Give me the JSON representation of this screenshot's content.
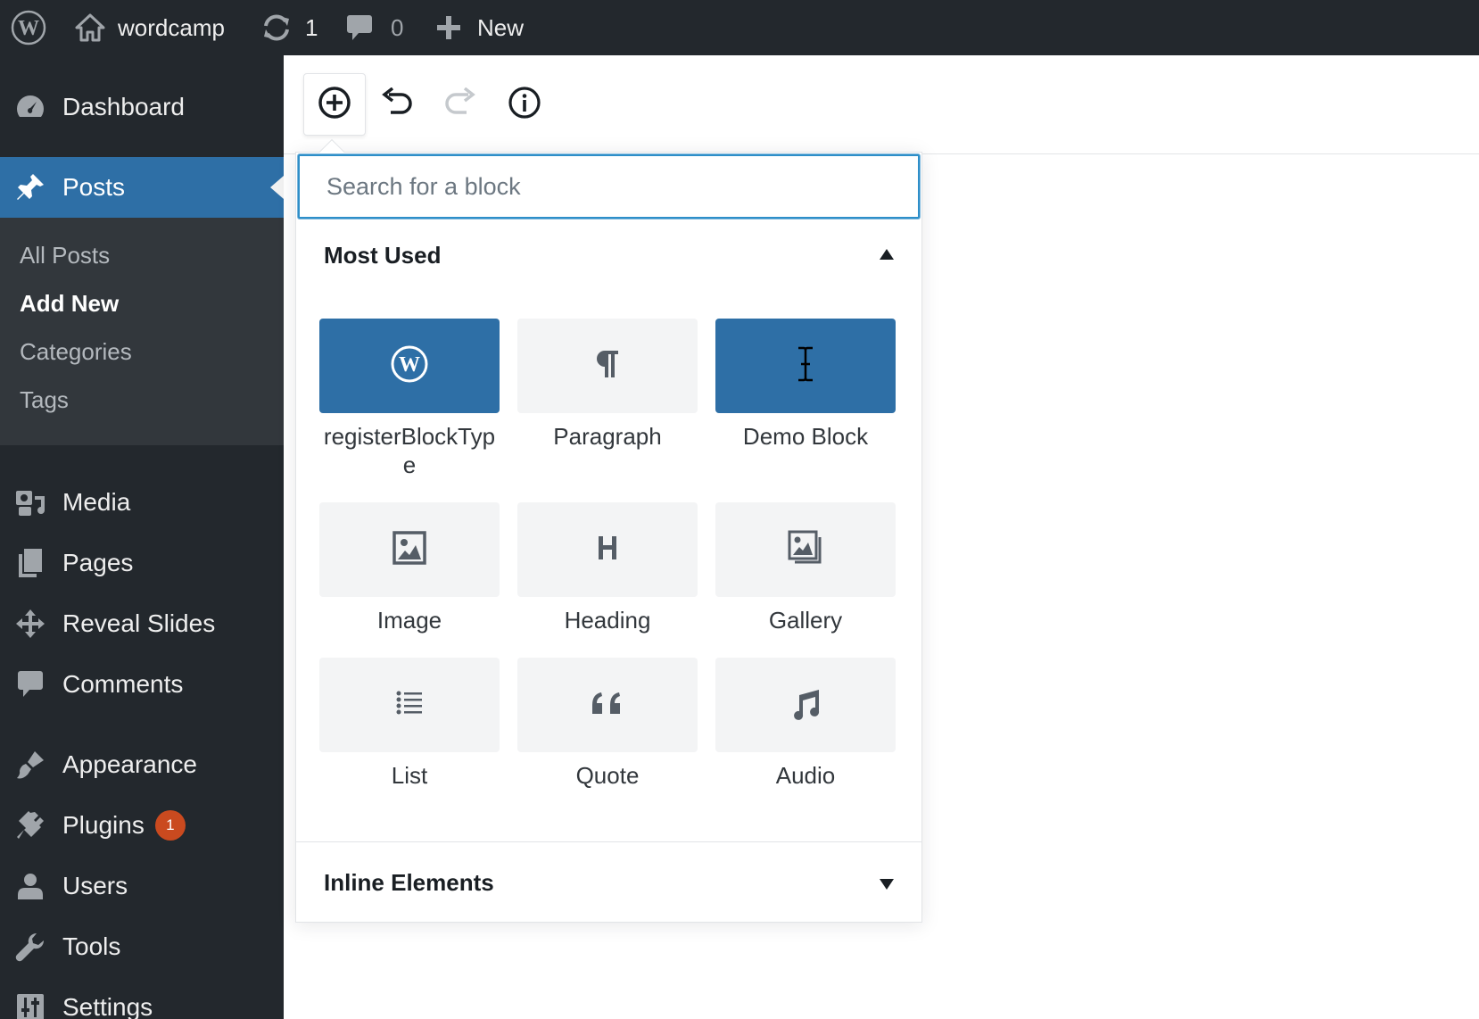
{
  "adminbar": {
    "site_name": "wordcamp",
    "updates_count": "1",
    "comments_count": "0",
    "new_label": "New"
  },
  "sidebar": {
    "items": [
      {
        "label": "Dashboard",
        "icon": "dashboard-icon"
      },
      {
        "label": "Posts",
        "icon": "pin-icon",
        "current": true
      },
      {
        "label": "Media",
        "icon": "media-icon"
      },
      {
        "label": "Pages",
        "icon": "pages-icon"
      },
      {
        "label": "Reveal Slides",
        "icon": "move-icon"
      },
      {
        "label": "Comments",
        "icon": "comment-icon"
      },
      {
        "label": "Appearance",
        "icon": "brush-icon"
      },
      {
        "label": "Plugins",
        "icon": "plug-icon",
        "badge": "1"
      },
      {
        "label": "Users",
        "icon": "user-icon"
      },
      {
        "label": "Tools",
        "icon": "wrench-icon"
      },
      {
        "label": "Settings",
        "icon": "sliders-icon"
      }
    ],
    "submenu": [
      {
        "label": "All Posts"
      },
      {
        "label": "Add New",
        "active": true
      },
      {
        "label": "Categories"
      },
      {
        "label": "Tags"
      }
    ]
  },
  "inserter": {
    "search_placeholder": "Search for a block",
    "most_used_title": "Most Used",
    "inline_title": "Inline Elements",
    "blocks": [
      {
        "label": "registerBlockType",
        "icon": "wordpress-icon",
        "selected": true
      },
      {
        "label": "Paragraph",
        "icon": "paragraph-icon"
      },
      {
        "label": "Demo Block",
        "icon": "text-cursor-icon",
        "selected": true
      },
      {
        "label": "Image",
        "icon": "image-icon"
      },
      {
        "label": "Heading",
        "icon": "heading-icon"
      },
      {
        "label": "Gallery",
        "icon": "gallery-icon"
      },
      {
        "label": "List",
        "icon": "list-icon"
      },
      {
        "label": "Quote",
        "icon": "quote-icon"
      },
      {
        "label": "Audio",
        "icon": "audio-icon"
      }
    ]
  },
  "colors": {
    "adminbar_bg": "#23282d",
    "menu_current": "#2e6fa6",
    "submenu_bg": "#32373c",
    "badge": "#ca4a1f",
    "search_focus": "#2e8fc9"
  }
}
